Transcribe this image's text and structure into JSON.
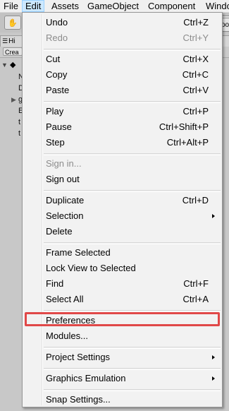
{
  "menubar": {
    "items": [
      {
        "label": "File",
        "active": false
      },
      {
        "label": "Edit",
        "active": true
      },
      {
        "label": "Assets",
        "active": false
      },
      {
        "label": "GameObject",
        "active": false
      },
      {
        "label": "Component",
        "active": false
      },
      {
        "label": "Windo",
        "active": false
      }
    ]
  },
  "background": {
    "hierarchy_tab": "Hi",
    "create_button": "Crea",
    "right_button_text": "oo",
    "tree_letters": [
      "N",
      "D",
      "g",
      "E",
      "t",
      "t"
    ]
  },
  "edit_menu": {
    "items": [
      {
        "label": "Undo",
        "shortcut": "Ctrl+Z",
        "enabled": true
      },
      {
        "label": "Redo",
        "shortcut": "Ctrl+Y",
        "enabled": false
      },
      {
        "label": "Cut",
        "shortcut": "Ctrl+X",
        "enabled": true
      },
      {
        "label": "Copy",
        "shortcut": "Ctrl+C",
        "enabled": true
      },
      {
        "label": "Paste",
        "shortcut": "Ctrl+V",
        "enabled": true
      },
      {
        "label": "Play",
        "shortcut": "Ctrl+P",
        "enabled": true
      },
      {
        "label": "Pause",
        "shortcut": "Ctrl+Shift+P",
        "enabled": true
      },
      {
        "label": "Step",
        "shortcut": "Ctrl+Alt+P",
        "enabled": true
      },
      {
        "label": "Sign in...",
        "shortcut": "",
        "enabled": false
      },
      {
        "label": "Sign out",
        "shortcut": "",
        "enabled": true
      },
      {
        "label": "Duplicate",
        "shortcut": "Ctrl+D",
        "enabled": true
      },
      {
        "label": "Selection",
        "shortcut": "",
        "enabled": true,
        "submenu": true
      },
      {
        "label": "Delete",
        "shortcut": "",
        "enabled": true
      },
      {
        "label": "Frame Selected",
        "shortcut": "",
        "enabled": true
      },
      {
        "label": "Lock View to Selected",
        "shortcut": "",
        "enabled": true
      },
      {
        "label": "Find",
        "shortcut": "Ctrl+F",
        "enabled": true
      },
      {
        "label": "Select All",
        "shortcut": "Ctrl+A",
        "enabled": true
      },
      {
        "label": "Preferences",
        "shortcut": "",
        "enabled": true,
        "highlighted": true
      },
      {
        "label": "Modules...",
        "shortcut": "",
        "enabled": true
      },
      {
        "label": "Project Settings",
        "shortcut": "",
        "enabled": true,
        "submenu": true
      },
      {
        "label": "Graphics Emulation",
        "shortcut": "",
        "enabled": true,
        "submenu": true
      },
      {
        "label": "Snap Settings...",
        "shortcut": "",
        "enabled": true
      }
    ]
  },
  "colors": {
    "highlight_outline": "#e04848",
    "menu_background": "#f2f2f2",
    "active_menubar_item": "#cce8ff",
    "disabled_text": "#8c8c8c"
  }
}
